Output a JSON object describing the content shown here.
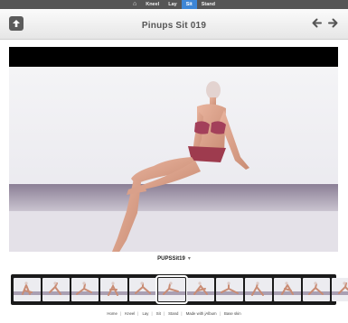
{
  "topnav": {
    "items": [
      {
        "label": "⌂",
        "active": false
      },
      {
        "label": "Kneel",
        "active": false
      },
      {
        "label": "Lay",
        "active": false
      },
      {
        "label": "Sit",
        "active": true
      },
      {
        "label": "Stand",
        "active": false
      }
    ]
  },
  "header": {
    "title": "Pinups Sit 019",
    "up_icon": "arrow-up-icon",
    "prev_icon": "arrow-left-icon",
    "next_icon": "arrow-right-icon"
  },
  "viewer": {
    "image_caption": "PUPSSit19",
    "caption_menu": "▾"
  },
  "thumbnails": {
    "count": 12,
    "selected_index": 5
  },
  "footer": {
    "links": [
      "Home",
      "Kneel",
      "Lay",
      "Sit",
      "Stand",
      "Made with jAlbum",
      "Base skin"
    ],
    "separator": "|"
  },
  "colors": {
    "topbar_bg": "#555555",
    "active_tab": "#3d86d6",
    "viewer_bg": "#000000",
    "strip_bg": "#1a1a1a"
  }
}
